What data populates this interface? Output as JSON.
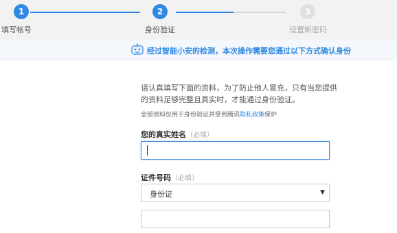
{
  "steps": [
    {
      "number": "1",
      "label": "填写帐号",
      "state": "done"
    },
    {
      "number": "2",
      "label": "身份验证",
      "state": "current"
    },
    {
      "number": "3",
      "label": "设置新密码",
      "state": "pending"
    }
  ],
  "notice": {
    "text": "经过智能小安的检测，本次操作需要您通过以下方式确认身份",
    "icon": "robot-icon"
  },
  "form": {
    "intro": "请认真填写下面的资料，为了防止他人冒充，只有当您提供的资料足够完整且真实时，才能通过身份验证。",
    "privacy_prefix": "全部资料仅用于身份验证并受到腾讯",
    "privacy_link": "隐私政策",
    "privacy_suffix": "保护",
    "name_label": "您的真实姓名",
    "name_hint": "（必填）",
    "name_value": "",
    "id_label": "证件号码",
    "id_hint": "（必填）",
    "id_type_selected": "身份证",
    "id_number_value": ""
  },
  "colors": {
    "accent": "#2f8ae5",
    "notice_bg": "#f4f7fb",
    "header_bg": "#f2f2f2"
  }
}
